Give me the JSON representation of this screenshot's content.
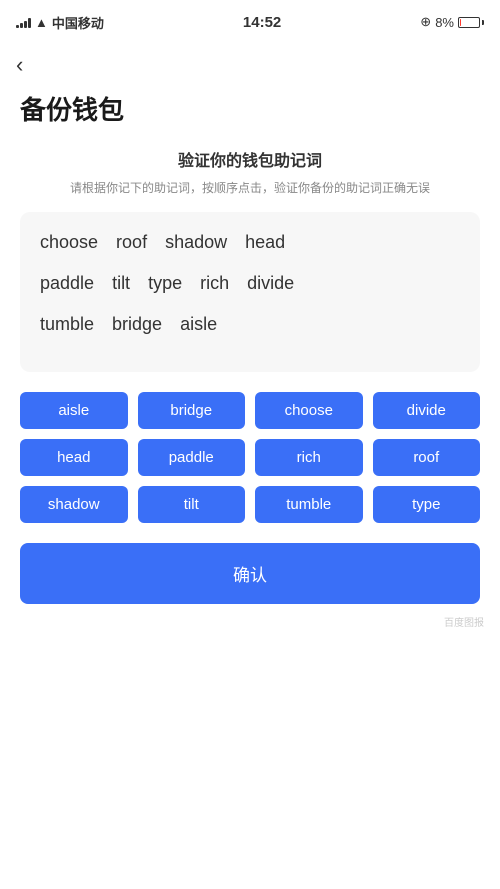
{
  "statusBar": {
    "carrier": "中国移动",
    "time": "14:52",
    "battery": "8%",
    "batteryLow": true
  },
  "back": "‹",
  "pageTitle": "备份钱包",
  "sectionTitle": "验证你的钱包助记词",
  "sectionDesc": "请根据你记下的助记词，按顺序点击，验证你备份的助记词正确无误",
  "displayWords": [
    [
      "choose",
      "roof",
      "shadow",
      "head"
    ],
    [
      "paddle",
      "tilt",
      "type",
      "rich",
      "divide"
    ],
    [
      "tumble",
      "bridge",
      "aisle"
    ]
  ],
  "chips": [
    "aisle",
    "bridge",
    "choose",
    "divide",
    "head",
    "paddle",
    "rich",
    "roof",
    "shadow",
    "tilt",
    "tumble",
    "type"
  ],
  "confirmLabel": "确认"
}
